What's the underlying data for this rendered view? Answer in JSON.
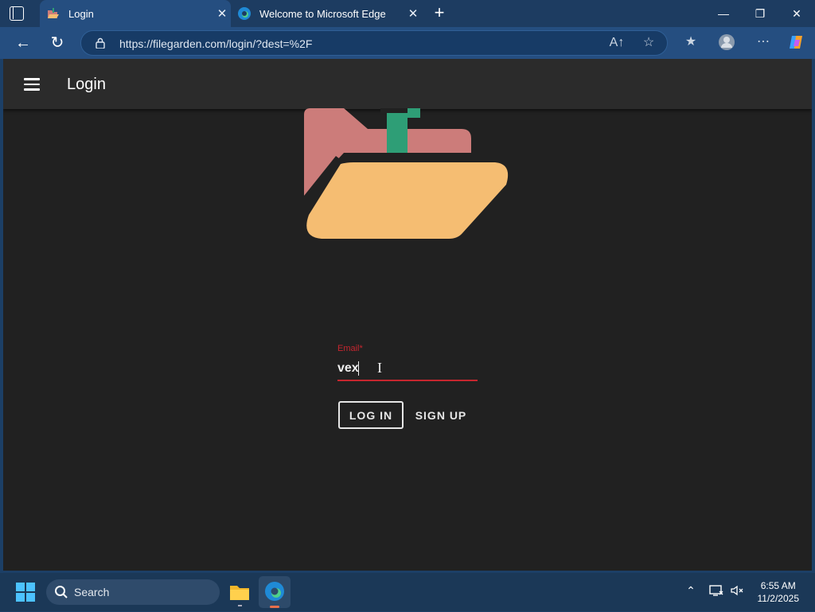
{
  "browser": {
    "tabs": [
      {
        "title": "Login",
        "active": true
      },
      {
        "title": "Welcome to Microsoft Edge",
        "active": false
      }
    ],
    "new_tab_label": "+",
    "url": "https://filegarden.com/login/?dest=%2F",
    "window_controls": {
      "minimize": "—",
      "restore": "❐",
      "close": "✕"
    },
    "icons": {
      "back": "←",
      "refresh": "↻",
      "read_aloud": "A↑",
      "favorite": "☆",
      "favorites": "★",
      "more": "⋯"
    }
  },
  "app": {
    "title": "Login",
    "email": {
      "label": "Email*",
      "value": "vex",
      "accent": "#c6262f"
    },
    "buttons": {
      "login": "LOG IN",
      "signup": "SIGN UP"
    },
    "logo_colors": {
      "back_folder": "#cc7c7a",
      "stem": "#2e9e76",
      "front_folder": "#f5bd72"
    }
  },
  "taskbar": {
    "search_label": "Search",
    "time": "6:55 AM",
    "date": "11/2/2025"
  }
}
